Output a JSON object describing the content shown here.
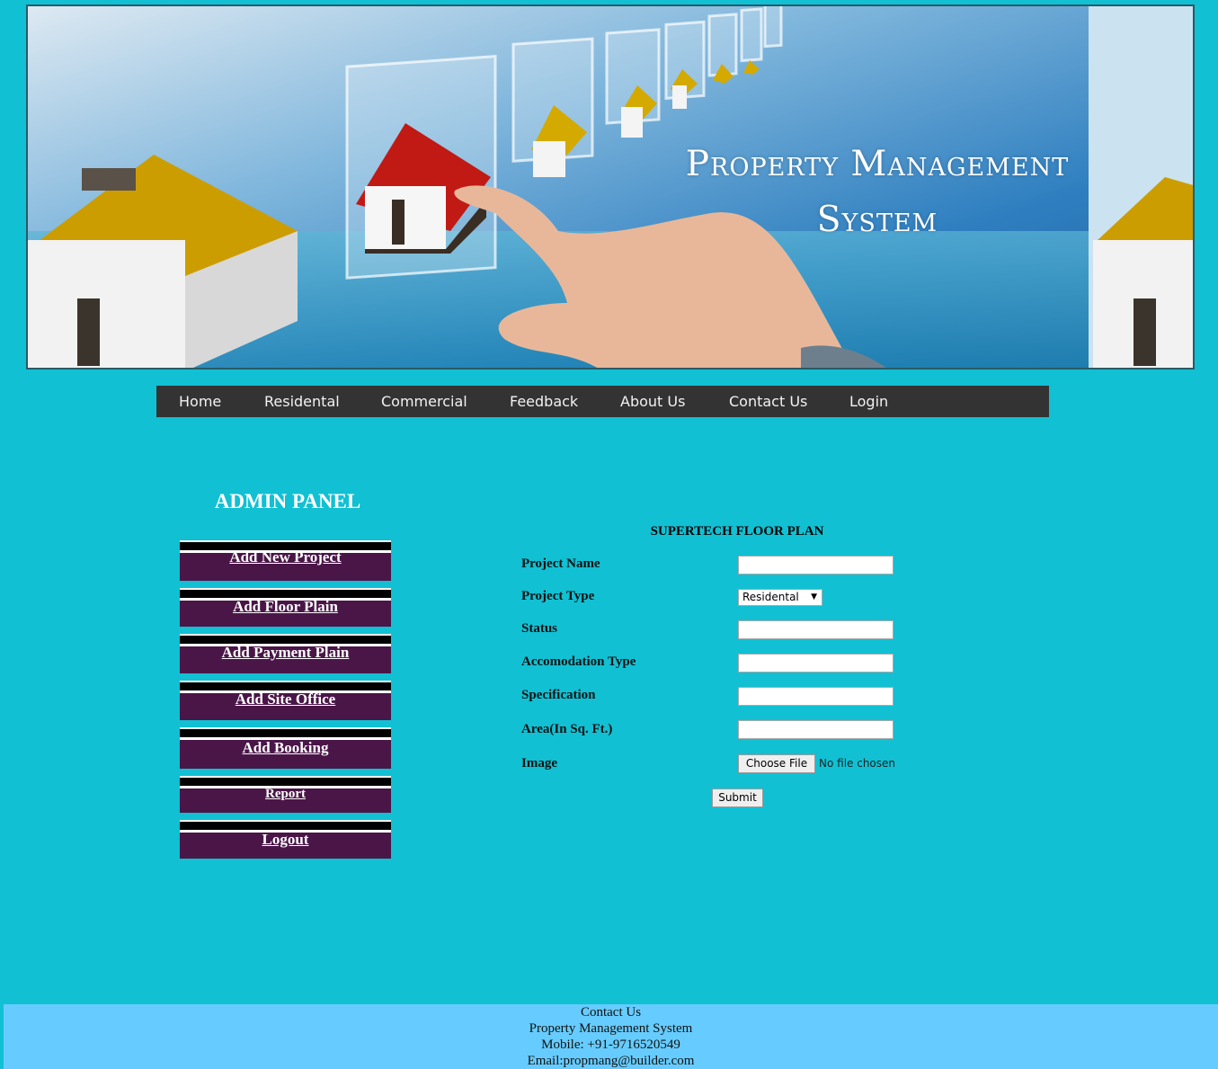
{
  "banner": {
    "title_line1": "Property Management",
    "title_line2": "System"
  },
  "nav": [
    "Home",
    "Residental",
    "Commercial",
    "Feedback",
    "About Us",
    "Contact Us",
    "Login"
  ],
  "admin": {
    "title": "ADMIN PANEL",
    "items": [
      "Add New Project",
      "Add Floor Plain",
      "Add Payment Plain",
      "Add Site Office",
      "Add Booking",
      "Report",
      "Logout"
    ]
  },
  "form": {
    "title": "SUPERTECH FLOOR PLAN",
    "labels": [
      "Project Name",
      "Project Type",
      "Status",
      "Accomodation Type",
      "Specification",
      "Area(In Sq. Ft.)",
      "Image"
    ],
    "project_type_value": "Residental",
    "file_button": "Choose File",
    "file_status": "No file chosen",
    "submit": "Submit"
  },
  "footer": {
    "lines": [
      "Contact Us",
      "Property Management System",
      "Mobile: +91-9716520549",
      "Email:propmang@builder.com"
    ]
  }
}
